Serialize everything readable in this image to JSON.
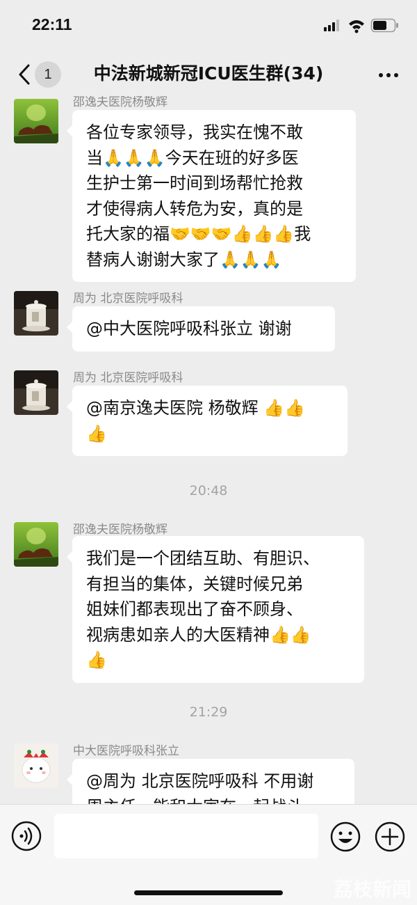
{
  "status_bar": {
    "time": "22:11"
  },
  "header": {
    "unread_count": "1",
    "title": "中法新城新冠ICU医生群(34)"
  },
  "messages": [
    {
      "sender": "邵逸夫医院杨敬辉",
      "lines": [
        "各位专家领导，我实在愧不敢",
        "当🙏🙏🙏今天在班的好多医",
        "生护士第一时间到场帮忙抢救",
        "才使得病人转危为安，真的是",
        "托大家的福🤝🤝🤝👍👍👍我",
        "替病人谢谢大家了🙏🙏🙏"
      ]
    },
    {
      "sender": "周为 北京医院呼吸科",
      "lines": [
        "@中大医院呼吸科张立 谢谢"
      ]
    },
    {
      "sender": "周为 北京医院呼吸科",
      "lines": [
        "@南京逸夫医院 杨敬辉 👍👍",
        "👍"
      ]
    },
    {
      "sender": "邵逸夫医院杨敬辉",
      "lines": [
        "我们是一个团结互助、有胆识、",
        "有担当的集体，关键时候兄弟",
        "姐妹们都表现出了奋不顾身、",
        "视病患如亲人的大医精神👍👍",
        "👍"
      ]
    },
    {
      "sender": "中大医院呼吸科张立",
      "lines": [
        "@周为 北京医院呼吸科 不用谢",
        "周主任，能和大家在一起战斗"
      ]
    }
  ],
  "timestamps": [
    "20:48",
    "21:29"
  ],
  "icons": {
    "back": "chevron-left-icon",
    "more": "more-dots-icon",
    "voice": "voice-icon",
    "emoji": "smiley-icon",
    "add": "plus-icon",
    "pray": "pray-emoji",
    "handshake": "handshake-emoji",
    "thumbs": "thumbs-up-emoji"
  },
  "watermark": "荔枝新闻"
}
